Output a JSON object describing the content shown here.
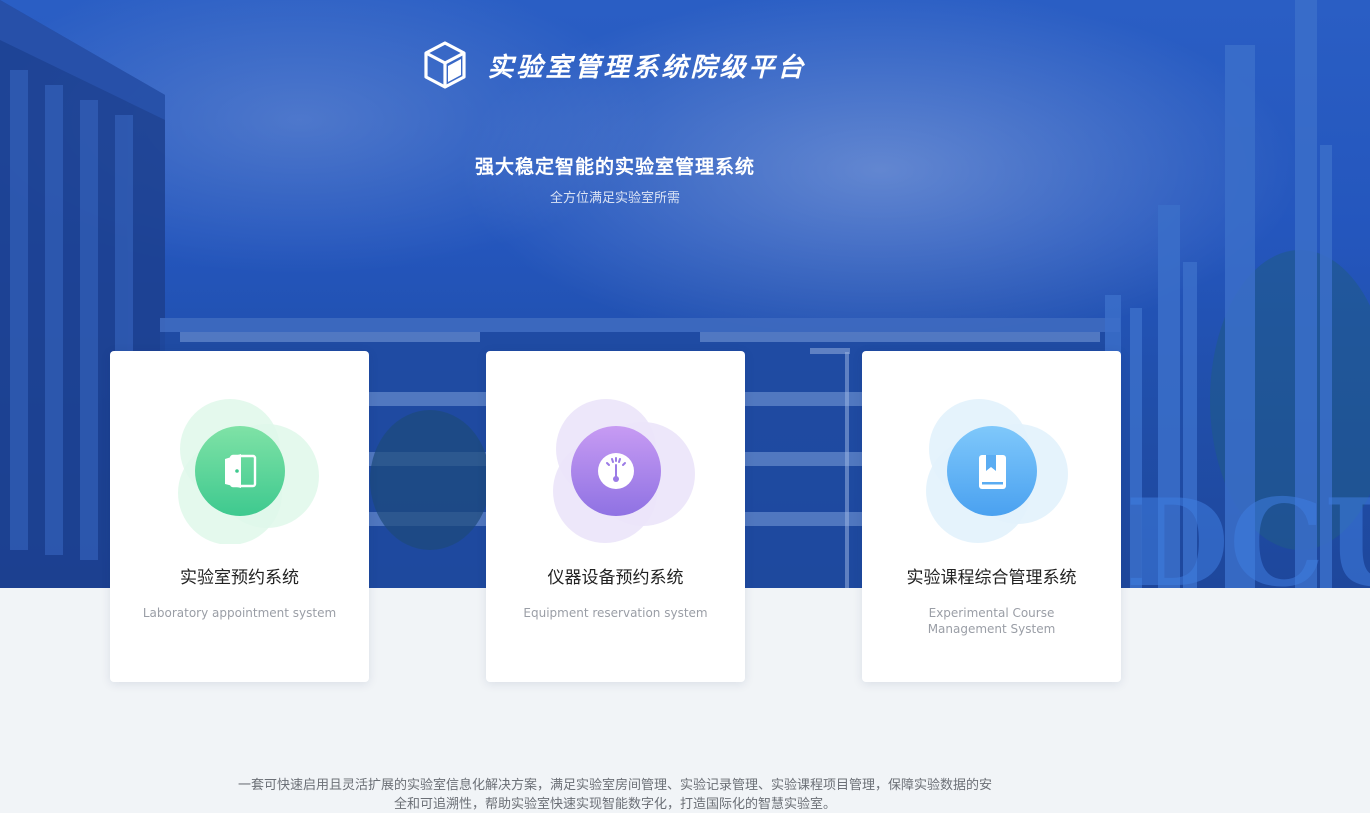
{
  "header": {
    "title": "实验室管理系统院级平台",
    "logo_icon": "cube-icon"
  },
  "hero": {
    "tagline": "强大稳定智能的实验室管理系统",
    "sub_tagline": "全方位满足实验室所需",
    "watermark": "DCU"
  },
  "cards": [
    {
      "title": "实验室预约系统",
      "subtitle": "Laboratory appointment system",
      "icon": "door-icon",
      "color_start": "#7fe2a6",
      "color_end": "#3ec98f",
      "halo": "#e0f8ec"
    },
    {
      "title": "仪器设备预约系统",
      "subtitle": "Equipment reservation system",
      "icon": "gauge-icon",
      "color_start": "#c79bf3",
      "color_end": "#8f72e3",
      "halo": "#ece6fa"
    },
    {
      "title": "实验课程综合管理系统",
      "subtitle": "Experimental Course Management System",
      "icon": "book-icon",
      "color_start": "#7fc8fb",
      "color_end": "#4aa1f0",
      "halo": "#e3f2fc"
    }
  ],
  "footer": {
    "description": "一套可快速启用且灵活扩展的实验室信息化解决方案，满足实验室房间管理、实验记录管理、实验课程项目管理，保障实验数据的安全和可追溯性，帮助实验室快速实现智能数字化，打造国际化的智慧实验室。"
  }
}
